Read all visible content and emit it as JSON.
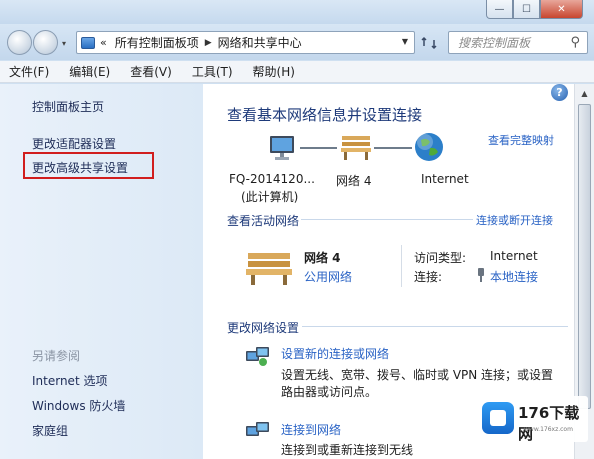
{
  "address_bar": {
    "crumbs": [
      "所有控制面板项",
      "网络和共享中心"
    ],
    "search_placeholder": "搜索控制面板"
  },
  "menu": [
    "文件(F)",
    "编辑(E)",
    "查看(V)",
    "工具(T)",
    "帮助(H)"
  ],
  "left_pane": {
    "links": [
      "控制面板主页",
      "更改适配器设置",
      "更改高级共享设置"
    ],
    "see_also_heading": "另请参阅",
    "see_also": [
      "Internet 选项",
      "Windows 防火墙",
      "家庭组"
    ],
    "highlight_color": "#d11e1e"
  },
  "main": {
    "title": "查看基本网络信息并设置连接",
    "view_full_map": "查看完整映射",
    "map": {
      "computer_name": "FQ-2014120...",
      "computer_sub": "(此计算机)",
      "network": "网络  4",
      "internet": "Internet"
    },
    "active_networks": {
      "heading": "查看活动网络",
      "connect_link": "连接或断开连接",
      "network_name": "网络  4",
      "network_type": "公用网络",
      "access_type_label": "访问类型:",
      "access_type_value": "Internet",
      "connection_label": "连接:",
      "connection_value": "本地连接"
    },
    "change_settings": {
      "heading": "更改网络设置",
      "item1_link": "设置新的连接或网络",
      "item1_desc_1": "设置无线、宽带、拨号、临时或 VPN 连接；或设置",
      "item1_desc_2": "路由器或访问点。",
      "item2_link": "连接到网络",
      "item2_desc": "连接到或重新连接到无线"
    }
  },
  "watermark": {
    "name": "176下载网",
    "url": "www.176xz.com"
  }
}
